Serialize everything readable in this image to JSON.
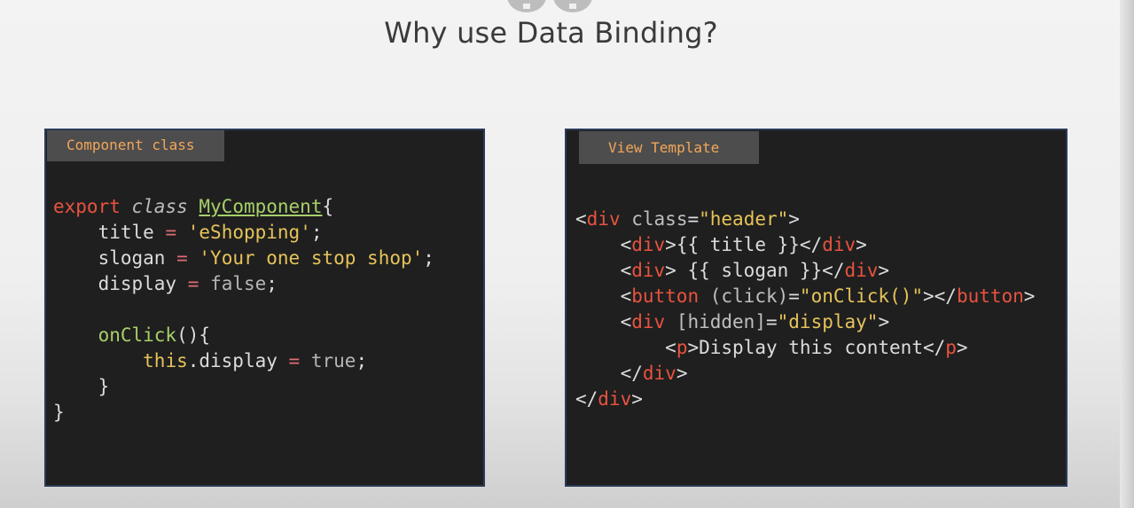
{
  "slide": {
    "title": "Why use Data Binding?"
  },
  "component_panel": {
    "label": "Component class",
    "line1": {
      "export": "export",
      "class": "class",
      "name": "MyComponent",
      "brace": "{"
    },
    "line2": {
      "prop": "title",
      "eq": "=",
      "value": "'eShopping'",
      "end": ";"
    },
    "line3": {
      "prop": "slogan",
      "eq": "=",
      "value": "'Your one stop shop'",
      "end": ";"
    },
    "line4": {
      "prop": "display",
      "eq": "=",
      "value": "false",
      "end": ";"
    },
    "line6": {
      "method": "onClick",
      "rest": "(){"
    },
    "line7": {
      "this": "this",
      "prop": ".display",
      "eq": "=",
      "value": "true",
      "end": ";"
    },
    "line8": "}",
    "line9": "}"
  },
  "template_panel": {
    "label": "View Template",
    "line1": {
      "open": "<",
      "tag": "div",
      "attr": "class",
      "eq": "=",
      "value": "\"header\"",
      "close": ">"
    },
    "line2": {
      "open": "<",
      "tag": "div",
      "mid": ">{{ title }}</",
      "tag2": "div",
      "close": ">"
    },
    "line3": {
      "open": "<",
      "tag": "div",
      "mid": "> {{ slogan }}</",
      "tag2": "div",
      "close": ">"
    },
    "line4": {
      "open": "<",
      "tag": "button",
      "attr": "(click)",
      "eq": "=",
      "value": "\"onClick()\"",
      "mid": "></",
      "tag2": "button",
      "close": ">"
    },
    "line5": {
      "open": "<",
      "tag": "div",
      "attr": "[hidden]",
      "eq": "=",
      "value": "\"display\"",
      "close": ">"
    },
    "line6": {
      "open": "<",
      "tag": "p",
      "mid": ">Display this content</",
      "tag2": "p",
      "close": ">"
    },
    "line7": {
      "open": "</",
      "tag": "div",
      "close": ">"
    },
    "line8": {
      "open": "</",
      "tag": "div",
      "close": ">"
    }
  }
}
